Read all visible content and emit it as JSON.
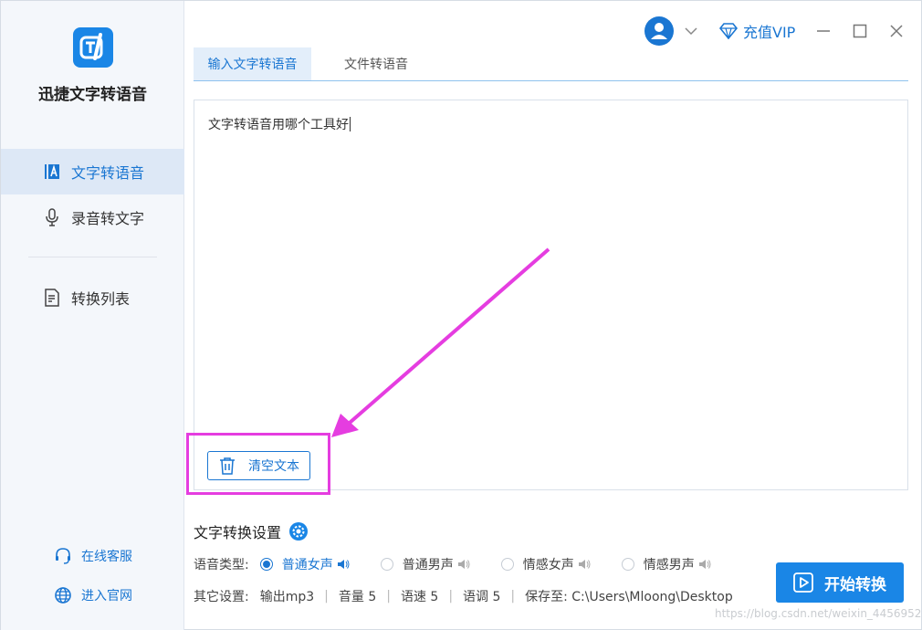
{
  "app": {
    "name": "迅捷文字转语音"
  },
  "sidebar": {
    "items": [
      {
        "label": "文字转语音",
        "icon": "text-a-icon",
        "active": true
      },
      {
        "label": "录音转文字",
        "icon": "microphone-icon",
        "active": false
      },
      {
        "label": "转换列表",
        "icon": "list-document-icon",
        "active": false
      }
    ],
    "footer": [
      {
        "label": "在线客服",
        "icon": "headset-icon"
      },
      {
        "label": "进入官网",
        "icon": "globe-icon"
      }
    ]
  },
  "titlebar": {
    "vip_label": "充值VIP"
  },
  "tabs": [
    {
      "label": "输入文字转语音",
      "active": true
    },
    {
      "label": "文件转语音",
      "active": false
    }
  ],
  "editor": {
    "text": "文字转语音用哪个工具好",
    "clear_label": "清空文本"
  },
  "settings": {
    "title": "文字转换设置",
    "voice_label": "语音类型:",
    "voice_options": [
      {
        "label": "普通女声",
        "selected": true
      },
      {
        "label": "普通男声",
        "selected": false
      },
      {
        "label": "情感女声",
        "selected": false
      },
      {
        "label": "情感男声",
        "selected": false
      }
    ],
    "other_label": "其它设置:",
    "output": "输出mp3",
    "volume": "音量 5",
    "speed": "语速 5",
    "pitch": "语调 5",
    "save_to": "保存至: C:\\Users\\Mloong\\Desktop"
  },
  "start_label": "开始转换",
  "watermark": "https://blog.csdn.net/weixin_44569520",
  "colors": {
    "accent": "#1a76d2",
    "annotation": "#e53de0"
  }
}
